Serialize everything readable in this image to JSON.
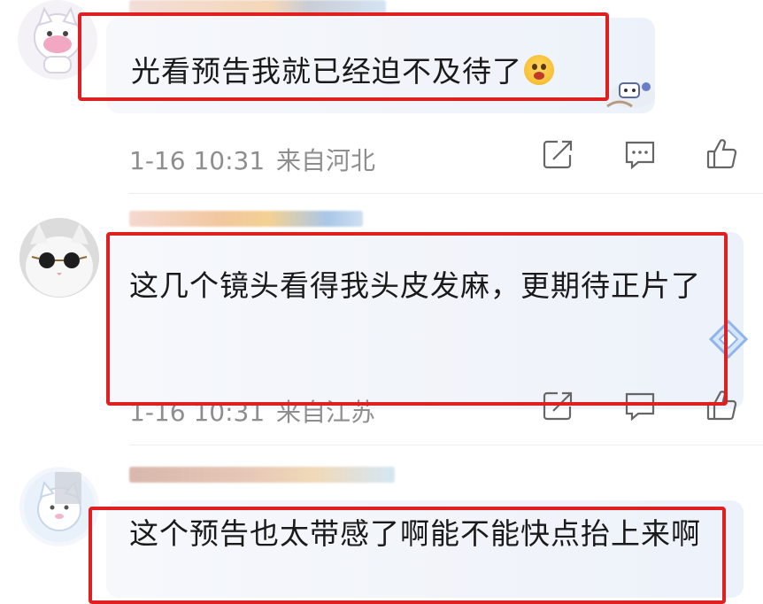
{
  "comments": [
    {
      "text": "光看预告我就已经迫不及待了",
      "time": "1-16 10:31",
      "location": "来自河北",
      "avatar": "cartoon-cat-avatar"
    },
    {
      "text": "这几个镜头看得我头皮发麻，更期待正片了",
      "time": "1-16 10:31",
      "location": "来自江苏",
      "avatar": "cat-with-sunglasses-avatar"
    },
    {
      "text": "这个预告也太带感了啊能不能快点抬上来啊",
      "avatar": "cartoon-cat-avatar-2"
    }
  ],
  "icons": {
    "share": "share-icon",
    "comment": "comment-icon",
    "like": "like-icon"
  },
  "colors": {
    "highlight_border": "#e02020",
    "meta_text": "#8e8e8e",
    "icon": "#666666"
  }
}
